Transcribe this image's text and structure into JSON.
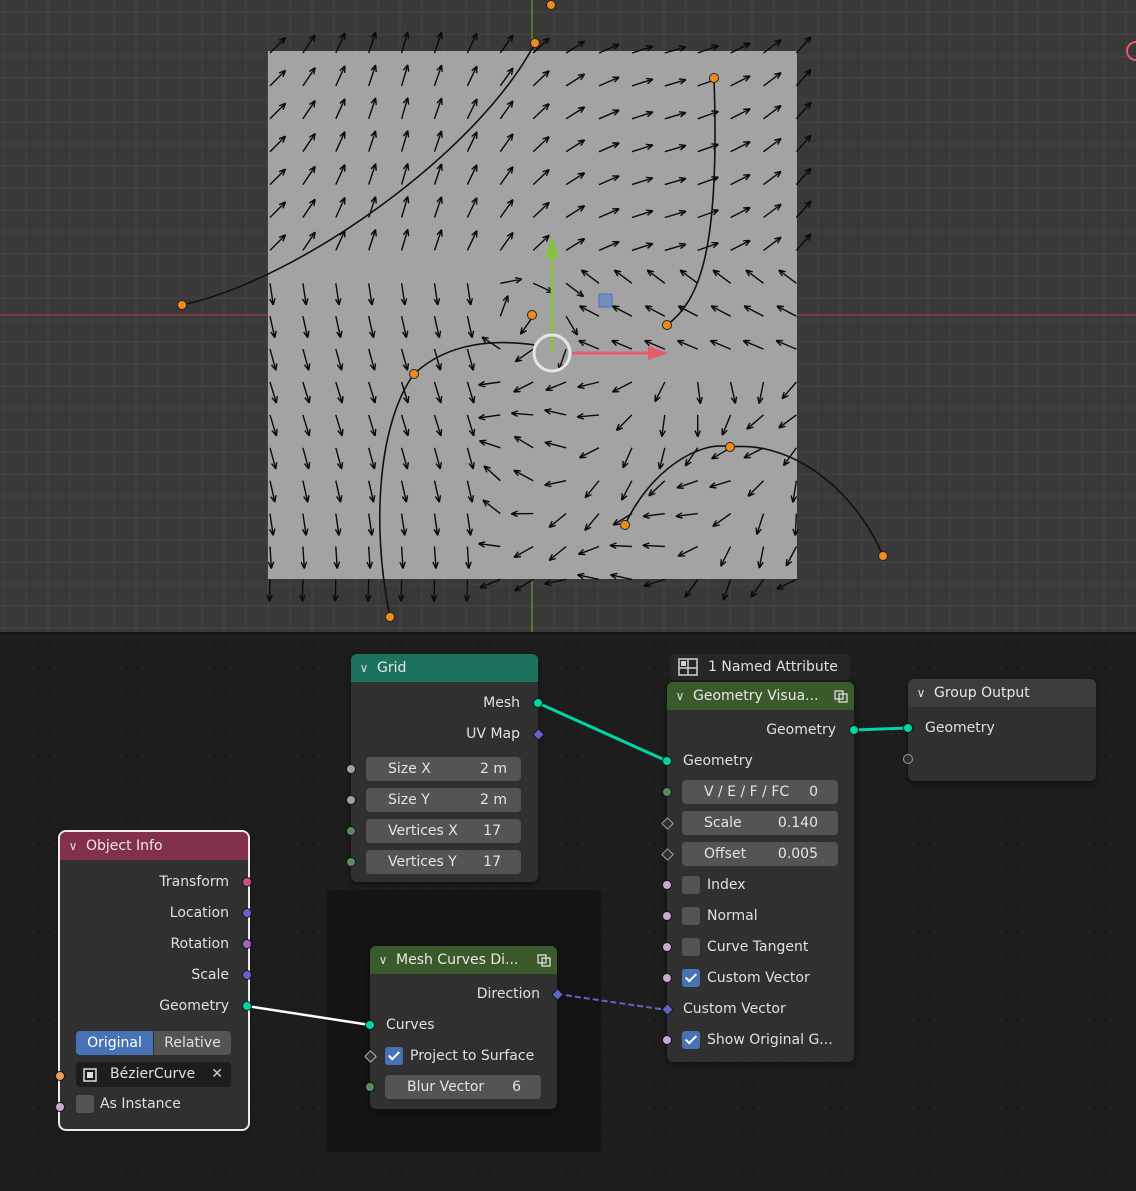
{
  "colors": {
    "grid_header": "#1d725e",
    "geometry_header": "#3b5a2c",
    "object_header": "#83314a",
    "output_header": "#3c3c3c",
    "geometry_socket": "#00d6a3",
    "float_socket": "#a1a1a1",
    "int_socket": "#598c5c",
    "vector_socket": "#6363c7",
    "rotation_socket": "#a663c7",
    "matrix_socket": "#cc4d85",
    "bool_socket": "#cca6d6",
    "object_socket": "#ed9e5c",
    "accent": "#4772b3"
  },
  "viewport": {
    "name": "3D Viewport"
  },
  "nodes": {
    "grid": {
      "title": "Grid",
      "mesh": "Mesh",
      "uv_map": "UV Map",
      "size_x_label": "Size X",
      "size_x_value": "2 m",
      "size_y_label": "Size Y",
      "size_y_value": "2 m",
      "vertices_x_label": "Vertices X",
      "vertices_x_value": "17",
      "vertices_y_label": "Vertices Y",
      "vertices_y_value": "17"
    },
    "named_attribute": {
      "label": "1 Named Attribute",
      "icon": "named-attribute-icon"
    },
    "geometry_visualizer": {
      "title": "Geometry Visua...",
      "geometry_out": "Geometry",
      "geometry_in": "Geometry",
      "mode_label": "V / E / F / FC",
      "mode_value": "0",
      "scale_label": "Scale",
      "scale_value": "0.140",
      "offset_label": "Offset",
      "offset_value": "0.005",
      "index": "Index",
      "index_checked": false,
      "normal": "Normal",
      "normal_checked": false,
      "curve_tangent": "Curve Tangent",
      "curve_tangent_checked": false,
      "custom_vector_toggle": "Custom Vector",
      "custom_vector_toggle_checked": true,
      "custom_vector": "Custom Vector",
      "show_original": "Show Original G...",
      "show_original_checked": true
    },
    "group_output": {
      "title": "Group Output",
      "geometry": "Geometry"
    },
    "object_info": {
      "title": "Object Info",
      "transform": "Transform",
      "location": "Location",
      "rotation": "Rotation",
      "scale": "Scale",
      "geometry": "Geometry",
      "mode_original": "Original",
      "mode_relative": "Relative",
      "mode_selected": "Original",
      "object_value": "BézierCurve",
      "as_instance": "As Instance",
      "as_instance_checked": false
    },
    "mesh_curves": {
      "title": "Mesh Curves Di...",
      "direction": "Direction",
      "curves": "Curves",
      "project_to_surface": "Project to Surface",
      "project_checked": true,
      "blur_label": "Blur Vector",
      "blur_value": "6"
    }
  }
}
